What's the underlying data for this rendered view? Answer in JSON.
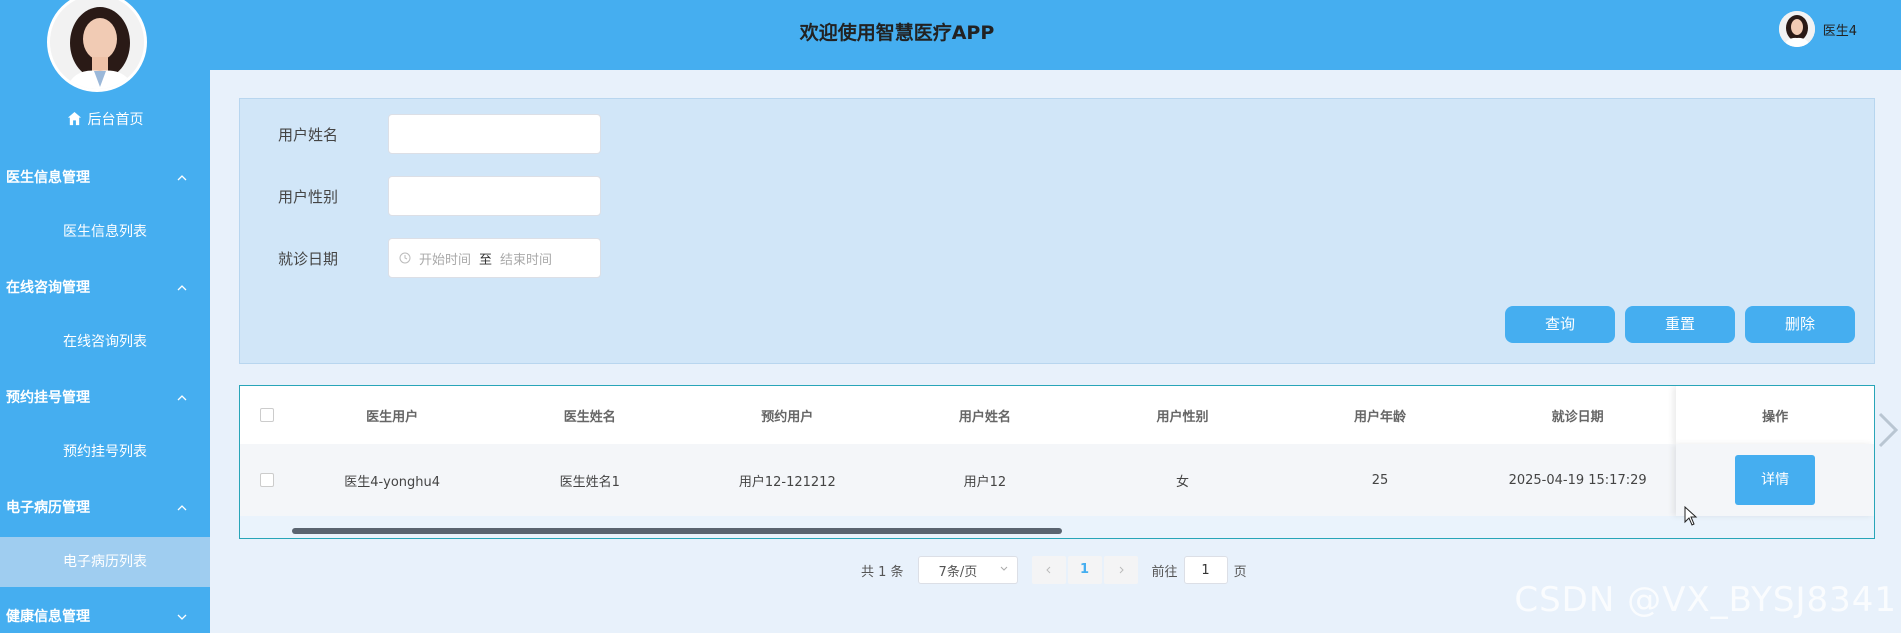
{
  "sidebar": {
    "home_label": "后台首页",
    "groups": [
      {
        "label": "医生信息管理",
        "sub": "医生信息列表"
      },
      {
        "label": "在线咨询管理",
        "sub": "在线咨询列表"
      },
      {
        "label": "预约挂号管理",
        "sub": "预约挂号列表"
      },
      {
        "label": "电子病历管理",
        "sub": "电子病历列表"
      },
      {
        "label": "健康信息管理"
      }
    ]
  },
  "header": {
    "title": "欢迎使用智慧医疗APP",
    "user_name": "医生4"
  },
  "search": {
    "user_name_label": "用户姓名",
    "user_gender_label": "用户性别",
    "visit_date_label": "就诊日期",
    "start_placeholder": "开始时间",
    "range_separator": "至",
    "end_placeholder": "结束时间",
    "query_button": "查询",
    "reset_button": "重置",
    "delete_button": "删除"
  },
  "table": {
    "columns": [
      "医生用户",
      "医生姓名",
      "预约用户",
      "用户姓名",
      "用户性别",
      "用户年龄",
      "就诊日期",
      "操作"
    ],
    "rows": [
      [
        "医生4-yonghu4",
        "医生姓名1",
        "用户12-121212",
        "用户12",
        "女",
        "25",
        "2025-04-19 15:17:29"
      ]
    ],
    "detail_button": "详情"
  },
  "pagination": {
    "total_text": "共 1 条",
    "page_size": "7条/页",
    "current_page": "1",
    "goto_prefix": "前往",
    "goto_value": "1",
    "goto_suffix": "页"
  },
  "watermark": "CSDN @VX_BYSJ8341",
  "colors": {
    "accent": "#45aef0",
    "active_menu": "#9fcdf0",
    "panel": "#d1e6f8"
  }
}
